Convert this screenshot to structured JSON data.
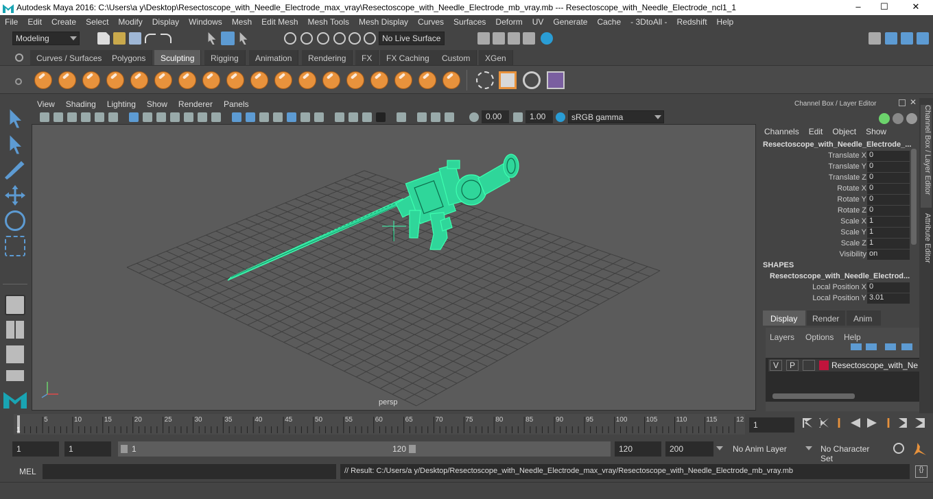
{
  "window": {
    "title": "Autodesk Maya 2016: C:\\Users\\a y\\Desktop\\Resectoscope_with_Needle_Electrode_max_vray\\Resectoscope_with_Needle_Electrode_mb_vray.mb   ---   Resectoscope_with_Needle_Electrode_ncl1_1",
    "min": "–",
    "max": "☐",
    "close": "✕"
  },
  "menus": [
    "File",
    "Edit",
    "Create",
    "Select",
    "Modify",
    "Display",
    "Windows",
    "Mesh",
    "Edit Mesh",
    "Mesh Tools",
    "Mesh Display",
    "Curves",
    "Surfaces",
    "Deform",
    "UV",
    "Generate",
    "Cache",
    "- 3DtoAll -",
    "Redshift",
    "Help"
  ],
  "status": {
    "mode": "Modeling",
    "live_surface": "No Live Surface"
  },
  "shelf_tabs": [
    "Curves / Surfaces",
    "Polygons",
    "Sculpting",
    "Rigging",
    "Animation",
    "Rendering",
    "FX",
    "FX Caching",
    "Custom",
    "XGen"
  ],
  "active_shelf": "Sculpting",
  "panel_menus": [
    "View",
    "Shading",
    "Lighting",
    "Show",
    "Renderer",
    "Panels"
  ],
  "panel_toolbar": {
    "value1": "0.00",
    "value2": "1.00",
    "colorspace": "sRGB gamma"
  },
  "viewport": {
    "camera": "persp"
  },
  "channel_box": {
    "header": "Channel Box / Layer Editor",
    "menus": [
      "Channels",
      "Edit",
      "Object",
      "Show"
    ],
    "object": "Resectoscope_with_Needle_Electrode_...",
    "channels": [
      {
        "name": "Translate X",
        "value": "0"
      },
      {
        "name": "Translate Y",
        "value": "0"
      },
      {
        "name": "Translate Z",
        "value": "0"
      },
      {
        "name": "Rotate X",
        "value": "0"
      },
      {
        "name": "Rotate Y",
        "value": "0"
      },
      {
        "name": "Rotate Z",
        "value": "0"
      },
      {
        "name": "Scale X",
        "value": "1"
      },
      {
        "name": "Scale Y",
        "value": "1"
      },
      {
        "name": "Scale Z",
        "value": "1"
      },
      {
        "name": "Visibility",
        "value": "on"
      }
    ],
    "shapes_label": "SHAPES",
    "shape_name": "Resectoscope_with_Needle_Electrod...",
    "shape_channels": [
      {
        "name": "Local Position X",
        "value": "0"
      },
      {
        "name": "Local Position Y",
        "value": "3.01"
      }
    ]
  },
  "layer_editor": {
    "tabs": [
      "Display",
      "Render",
      "Anim"
    ],
    "active": "Display",
    "menus": [
      "Layers",
      "Options",
      "Help"
    ],
    "layer": {
      "v": "V",
      "p": "P",
      "name": "Resectoscope_with_Need"
    }
  },
  "side_tabs": [
    "Channel Box / Layer Editor",
    "Attribute Editor"
  ],
  "timeline": {
    "ticks": [
      "5",
      "10",
      "15",
      "20",
      "25",
      "30",
      "35",
      "40",
      "45",
      "50",
      "55",
      "60",
      "65",
      "70",
      "75",
      "80",
      "85",
      "90",
      "95",
      "100",
      "105",
      "110",
      "115",
      "12"
    ],
    "current_frame": "1",
    "first": "1"
  },
  "range": {
    "start": "1",
    "current": "1",
    "slider_start": "1",
    "slider_end": "120",
    "end": "120",
    "max": "200",
    "anim_layer": "No Anim Layer",
    "char_set": "No Character Set"
  },
  "mel": {
    "label": "MEL",
    "result": "// Result: C:/Users/a y/Desktop/Resectoscope_with_Needle_Electrode_max_vray/Resectoscope_with_Needle_Electrode_mb_vray.mb"
  },
  "colors": {
    "accent": "#5d9bd3",
    "wire": "#3dffb0",
    "orange": "#e8923c",
    "layer_color": "#c0143c"
  }
}
